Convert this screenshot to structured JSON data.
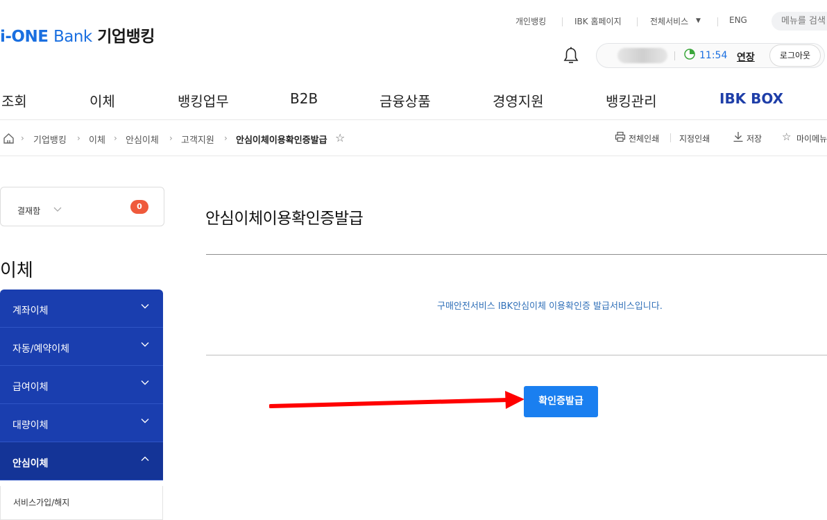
{
  "header": {
    "logo_brand": "i-ONE",
    "logo_bank": "Bank",
    "logo_ko": "기업뱅킹",
    "util_links": [
      "개인뱅킹",
      "IBK 홈페이지",
      "전체서비스",
      "ENG"
    ],
    "search_placeholder": "메뉴를 검색",
    "session": {
      "time": "11:54",
      "extend_label": "연장",
      "logout_label": "로그아웃"
    }
  },
  "gnb": [
    "조회",
    "이체",
    "뱅킹업무",
    "B2B",
    "금융상품",
    "경영지원",
    "뱅킹관리",
    "IBK BOX"
  ],
  "breadcrumb": [
    "기업뱅킹",
    "이체",
    "안심이체",
    "고객지원",
    "안심이체이용확인증발급"
  ],
  "tools": {
    "print_all": "전체인쇄",
    "print_selected": "지정인쇄",
    "save": "저장",
    "my_menu": "마이메뉴"
  },
  "sidebar": {
    "cart_label": "결재함",
    "cart_count": "0",
    "title": "이체",
    "items": [
      {
        "label": "계좌이체",
        "expanded": false
      },
      {
        "label": "자동/예약이체",
        "expanded": false
      },
      {
        "label": "급여이체",
        "expanded": false
      },
      {
        "label": "대량이체",
        "expanded": false
      },
      {
        "label": "안심이체",
        "expanded": true
      }
    ],
    "subitems": [
      "서비스가입/해지"
    ]
  },
  "main": {
    "title": "안심이체이용확인증발급",
    "description": "구매안전서비스 IBK안심이체 이용확인증 발급서비스입니다.",
    "issue_button": "확인증발급"
  },
  "colors": {
    "primary": "#1a6fe0",
    "nav_blue": "#1a3eaf",
    "button": "#1a7ff0",
    "badge": "#ef5a3c",
    "annotation_arrow": "#ff0000"
  }
}
